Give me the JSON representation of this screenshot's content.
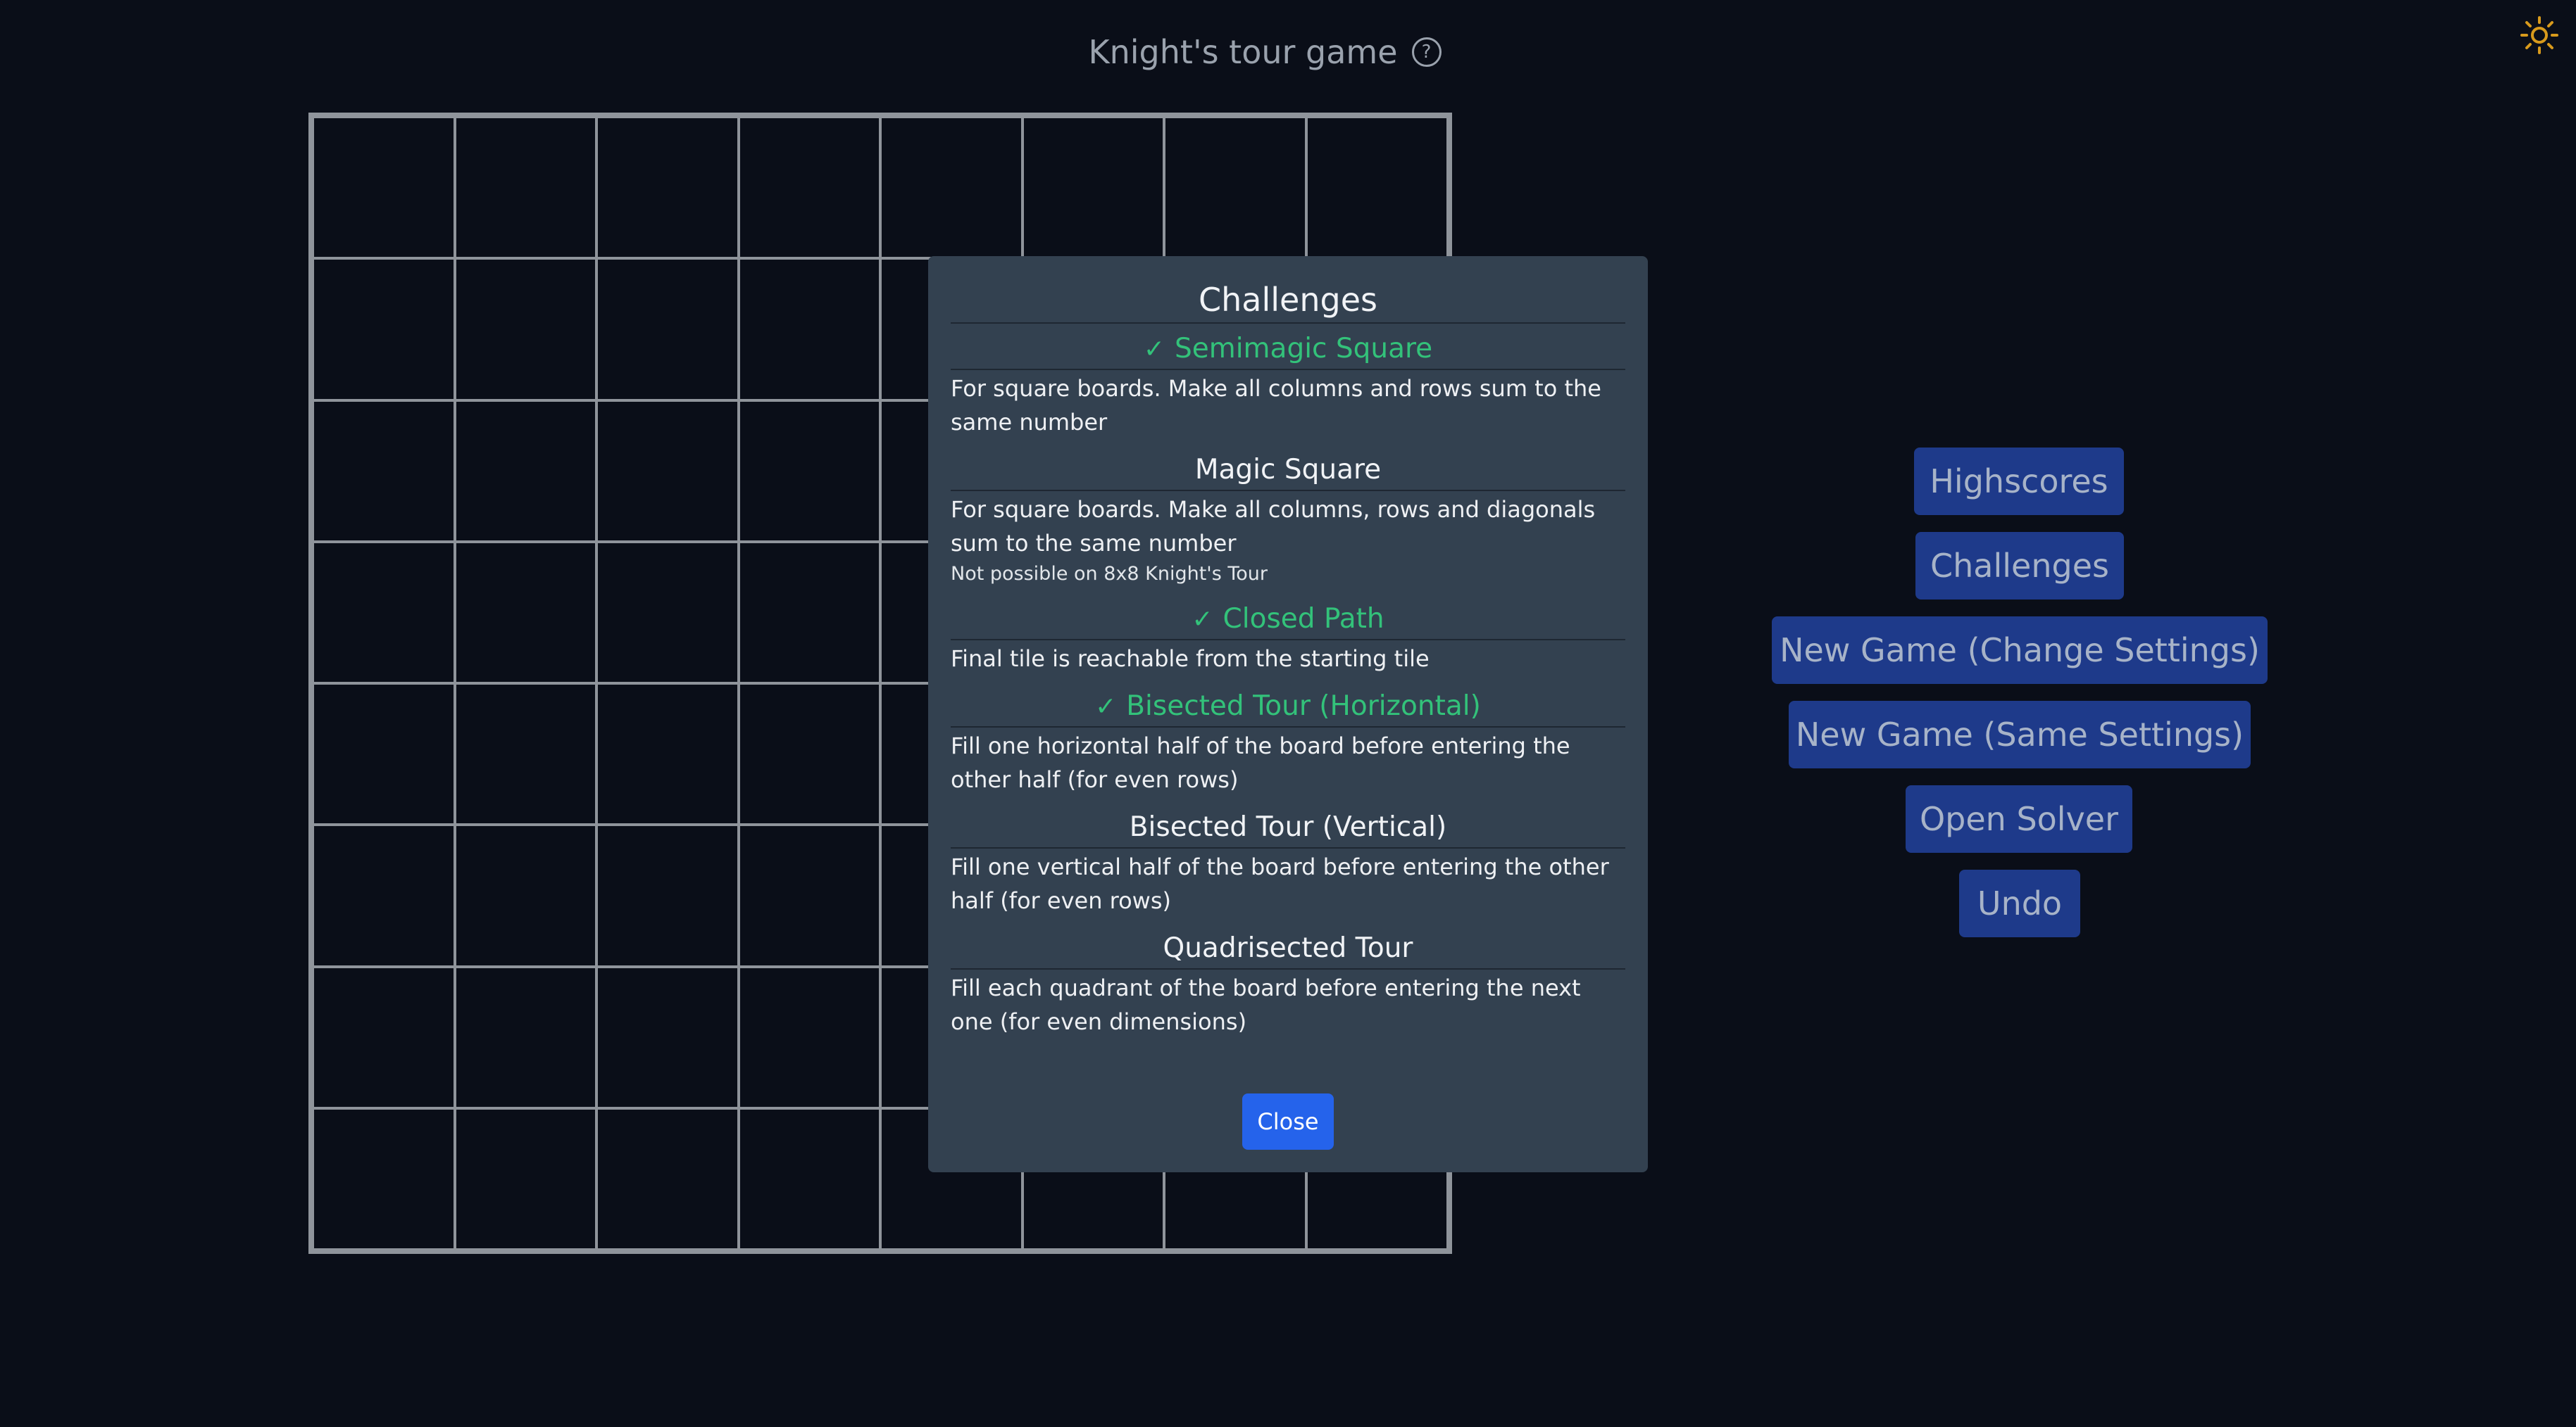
{
  "header": {
    "title": "Knight's tour game",
    "help_icon": "question-circle-icon",
    "theme_icon": "sun-icon",
    "theme_icon_color": "#d89a1c"
  },
  "board": {
    "rows": 8,
    "columns": 8
  },
  "challenges_modal": {
    "title": "Challenges",
    "items": [
      {
        "name": "Semimagic Square",
        "completed": true,
        "description": "For square boards. Make all columns and rows sum to the same number",
        "note": ""
      },
      {
        "name": "Magic Square",
        "completed": false,
        "description": "For square boards. Make all columns, rows and diagonals sum to the same number",
        "note": "Not possible on 8x8 Knight's Tour"
      },
      {
        "name": "Closed Path",
        "completed": true,
        "description": "Final tile is reachable from the starting tile",
        "note": ""
      },
      {
        "name": "Bisected Tour (Horizontal)",
        "completed": true,
        "description": "Fill one horizontal half of the board before entering the other half (for even rows)",
        "note": ""
      },
      {
        "name": "Bisected Tour (Vertical)",
        "completed": false,
        "description": "Fill one vertical half of the board before entering the other half (for even rows)",
        "note": ""
      },
      {
        "name": "Quadrisected Tour",
        "completed": false,
        "description": "Fill each quadrant of the board before entering the next one (for even dimensions)",
        "note": ""
      }
    ],
    "close_label": "Close"
  },
  "sidebar": {
    "highscores_label": "Highscores",
    "challenges_label": "Challenges",
    "new_game_change_label": "New Game (Change Settings)",
    "new_game_same_label": "New Game (Same Settings)",
    "open_solver_label": "Open Solver",
    "undo_label": "Undo"
  },
  "colors": {
    "background": "#0a0e18",
    "modal_background": "#334150",
    "completed_green": "#33c27a",
    "primary_button": "#2563eb",
    "side_button": "#1e3a8a",
    "grid_line": "#8f949b"
  }
}
